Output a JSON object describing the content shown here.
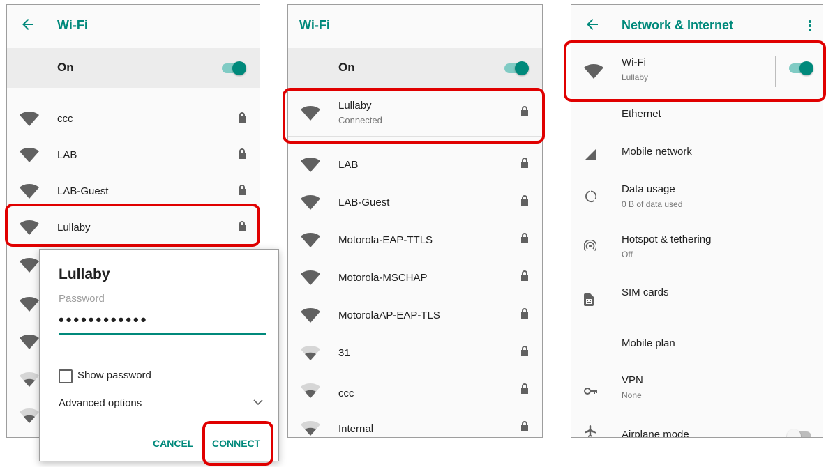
{
  "colors": {
    "accent": "#00897b",
    "highlight": "#e00000"
  },
  "panel1": {
    "title": "Wi-Fi",
    "toggle_label": "On",
    "networks": [
      {
        "name": "ccc",
        "icon": "wifi-full-icon",
        "locked": true
      },
      {
        "name": "LAB",
        "icon": "wifi-full-icon",
        "locked": true
      },
      {
        "name": "LAB-Guest",
        "icon": "wifi-full-icon",
        "locked": true
      },
      {
        "name": "Lullaby",
        "icon": "wifi-full-icon",
        "locked": true
      }
    ],
    "dialog": {
      "title": "Lullaby",
      "password_label": "Password",
      "password_mask": "••••••••••••",
      "show_password": "Show password",
      "advanced": "Advanced options",
      "cancel": "CANCEL",
      "connect": "CONNECT"
    }
  },
  "panel2": {
    "title": "Wi-Fi",
    "toggle_label": "On",
    "connected": {
      "name": "Lullaby",
      "status": "Connected"
    },
    "networks": [
      {
        "name": "LAB",
        "icon": "wifi-full-icon",
        "locked": true
      },
      {
        "name": "LAB-Guest",
        "icon": "wifi-full-icon",
        "locked": true
      },
      {
        "name": "Motorola-EAP-TTLS",
        "icon": "wifi-full-icon",
        "locked": true
      },
      {
        "name": "Motorola-MSCHAP",
        "icon": "wifi-full-icon",
        "locked": true
      },
      {
        "name": "MotorolaAP-EAP-TLS",
        "icon": "wifi-full-icon",
        "locked": true
      },
      {
        "name": "31",
        "icon": "wifi-weak-icon",
        "locked": true
      },
      {
        "name": "ccc",
        "icon": "wifi-weak-icon",
        "locked": true
      },
      {
        "name": "Internal",
        "icon": "wifi-weak-icon",
        "locked": true
      }
    ]
  },
  "panel3": {
    "title": "Network & Internet",
    "items": [
      {
        "label": "Wi-Fi",
        "sub": "Lullaby",
        "icon": "wifi-icon"
      },
      {
        "label": "Ethernet",
        "sub": "",
        "icon": ""
      },
      {
        "label": "Mobile network",
        "sub": "",
        "icon": "signal-icon"
      },
      {
        "label": "Data usage",
        "sub": "0 B of data used",
        "icon": "data-usage-icon"
      },
      {
        "label": "Hotspot & tethering",
        "sub": "Off",
        "icon": "hotspot-icon"
      },
      {
        "label": "SIM cards",
        "sub": "",
        "icon": "sim-card-icon"
      },
      {
        "label": "Mobile plan",
        "sub": "",
        "icon": ""
      },
      {
        "label": "VPN",
        "sub": "None",
        "icon": "vpn-key-icon"
      },
      {
        "label": "Airplane mode",
        "sub": "",
        "icon": "airplane-icon"
      }
    ]
  }
}
